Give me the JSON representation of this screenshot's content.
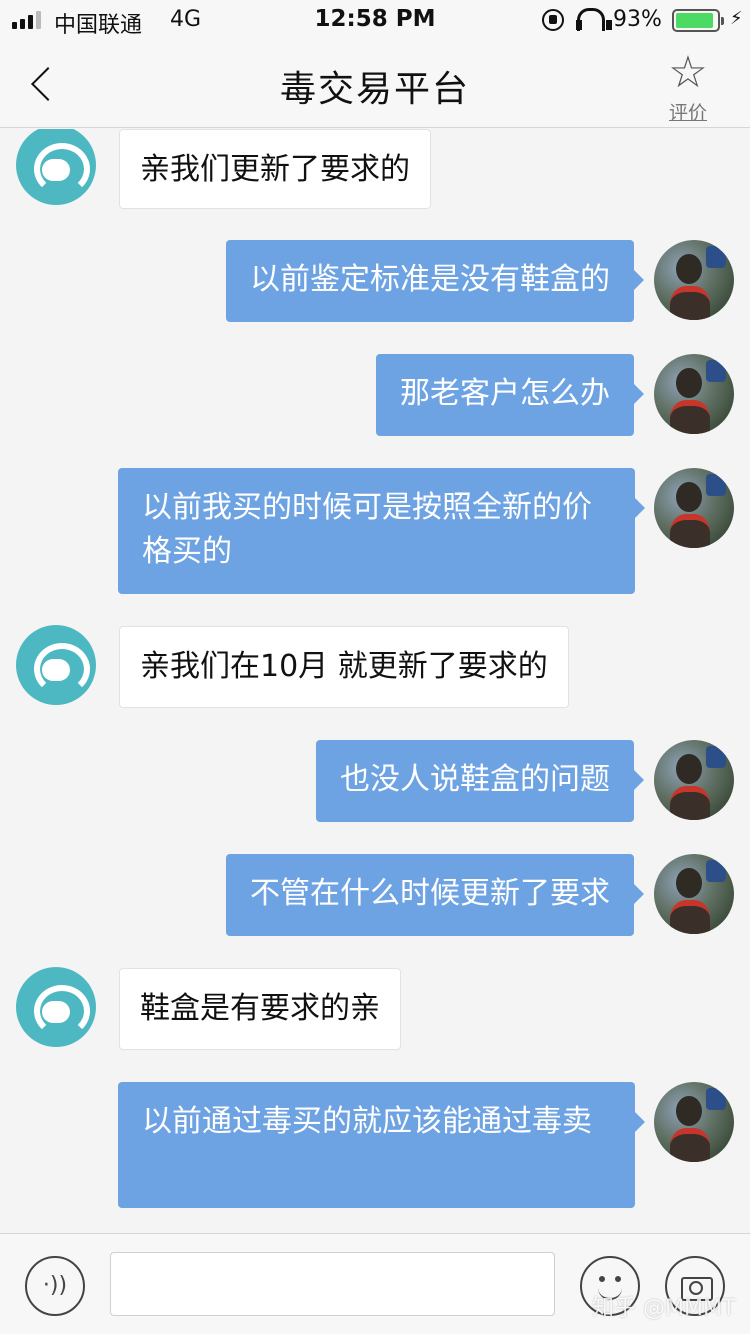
{
  "status_bar": {
    "carrier": "中国联通",
    "network": "4G",
    "time": "12:58 PM",
    "battery_percent": "93%",
    "battery_level": 0.93,
    "battery_color": "#4cd964"
  },
  "nav": {
    "back_icon": "chevron-left-icon",
    "title": "毒交易平台",
    "rate_icon": "star-icon",
    "rate_label": "评价"
  },
  "messages": [
    {
      "sender": "agent",
      "text": "亲我们更新了要求的"
    },
    {
      "sender": "user",
      "text": "以前鉴定标准是没有鞋盒的"
    },
    {
      "sender": "user",
      "text": "那老客户怎么办"
    },
    {
      "sender": "user",
      "text": "以前我买的时候可是按照全新的价格买的"
    },
    {
      "sender": "agent",
      "text": "亲我们在10月 就更新了要求的"
    },
    {
      "sender": "user",
      "text": "也没人说鞋盒的问题"
    },
    {
      "sender": "user",
      "text": "不管在什么时候更新了要求"
    },
    {
      "sender": "agent",
      "text": "鞋盒是有要求的亲"
    },
    {
      "sender": "user",
      "text": "以前通过毒买的就应该能通过毒卖"
    }
  ],
  "colors": {
    "user_bubble": "#6ea3e3",
    "agent_avatar": "#4db8c2"
  },
  "input_bar": {
    "voice_icon": "voice-icon",
    "emoji_icon": "emoji-icon",
    "camera_icon": "camera-icon",
    "input_value": ""
  },
  "watermark": "知乎 @MMMT"
}
